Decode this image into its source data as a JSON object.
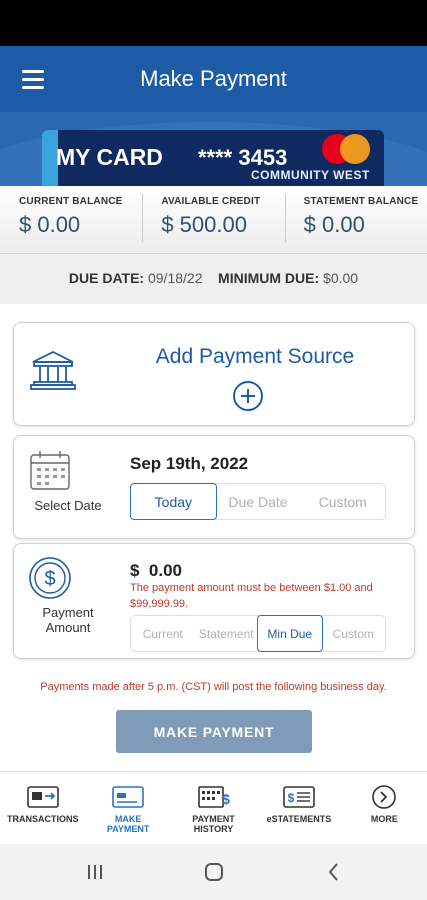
{
  "app_bar": {
    "title": "Make Payment"
  },
  "card": {
    "name": "MY CARD",
    "masked_number": "**** 3453",
    "bank_text": "COMMUNITY WEST"
  },
  "balances": [
    {
      "label": "CURRENT BALANCE",
      "value": "$ 0.00"
    },
    {
      "label": "AVAILABLE CREDIT",
      "value": "$ 500.00"
    },
    {
      "label": "STATEMENT BALANCE",
      "value": "$ 0.00"
    }
  ],
  "due": {
    "due_date_label": "DUE DATE:",
    "due_date_value": "09/18/22",
    "min_due_label": "MINIMUM DUE:",
    "min_due_value": "$0.00"
  },
  "add_source": {
    "label": "Add Payment Source"
  },
  "date_panel": {
    "label": "Select Date",
    "selected_date": "Sep 19th, 2022",
    "options": [
      "Today",
      "Due Date",
      "Custom"
    ]
  },
  "amount_panel": {
    "label_line1": "Payment",
    "label_line2": "Amount",
    "currency": "$",
    "amount_value": "0.00",
    "message": "The payment amount must be between $1.00 and $99,999.99.",
    "options": [
      "Current",
      "Statement",
      "Min Due",
      "Custom"
    ]
  },
  "notice": "Payments made after 5 p.m. (CST) will post the following business day.",
  "pay_button": "MAKE PAYMENT",
  "bottom_nav": [
    {
      "line1": "TRANSACTIONS",
      "line2": ""
    },
    {
      "line1": "MAKE",
      "line2": "PAYMENT"
    },
    {
      "line1": "PAYMENT",
      "line2": "HISTORY"
    },
    {
      "line1": "eSTATEMENTS",
      "line2": ""
    },
    {
      "line1": "MORE",
      "line2": ""
    }
  ],
  "icons": {
    "menu": "hamburger-icon",
    "bank": "bank-icon",
    "add": "plus-circle-icon",
    "calendar": "calendar-icon",
    "dollar": "dollar-circle-icon",
    "transactions": "card-transfer-icon",
    "make_payment": "card-icon",
    "history": "calculator-dollar-icon",
    "estatements": "statement-icon",
    "more": "chevron-right-circle-icon"
  },
  "colors": {
    "primary": "#1d5ba6",
    "error": "#c0392b",
    "button_disabled": "#7f9bb8",
    "mastercard_red": "#eb001b",
    "mastercard_orange": "#f79e1b"
  }
}
